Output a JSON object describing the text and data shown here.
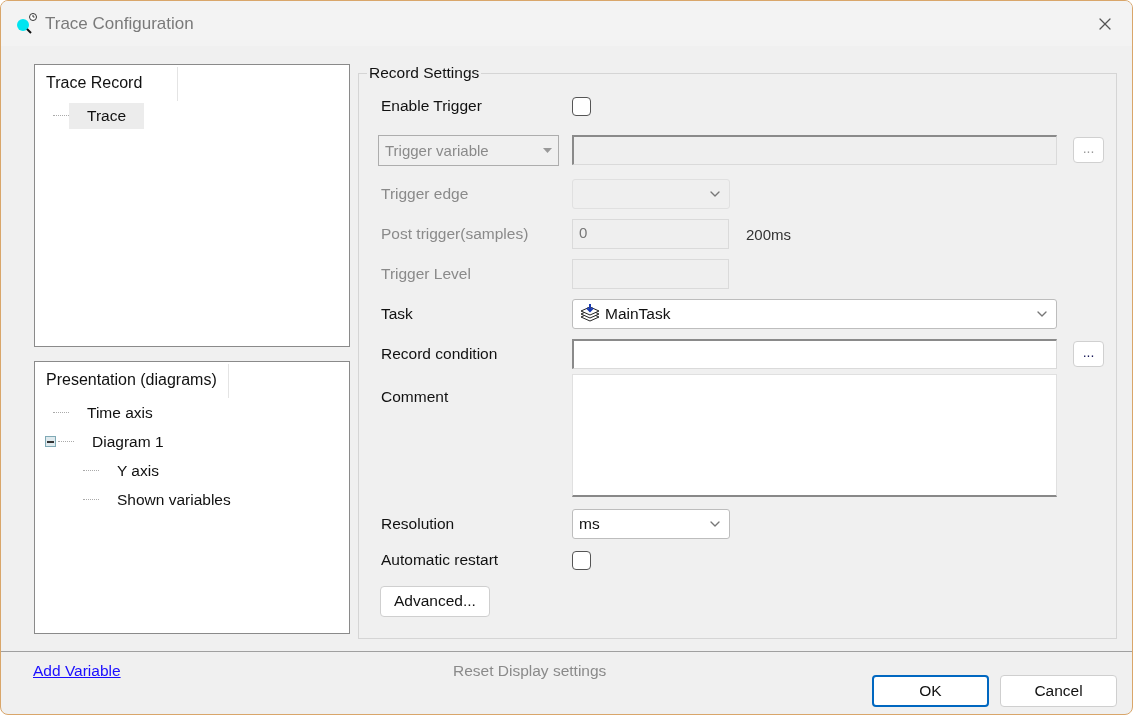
{
  "window": {
    "title": "Trace Configuration"
  },
  "trees": [
    {
      "header": "Trace Record",
      "items": [
        {
          "label": "Trace",
          "selected": true
        }
      ]
    },
    {
      "header": "Presentation (diagrams)",
      "items": [
        {
          "label": "Time axis",
          "selected": false
        },
        {
          "label": "Diagram 1",
          "selected": false,
          "expanded": true,
          "children": [
            {
              "label": "Y axis",
              "selected": false
            },
            {
              "label": "Shown variables",
              "selected": false
            }
          ]
        }
      ]
    }
  ],
  "record_settings": {
    "title": "Record Settings",
    "rows": [
      {
        "kind": "checkbox",
        "label": "Enable Trigger",
        "checked": false,
        "disabled": false
      },
      {
        "kind": "variable",
        "combo": "Trigger variable",
        "browse": "...",
        "disabled": true
      },
      {
        "kind": "dropdown",
        "label": "Trigger edge",
        "disabled": true
      },
      {
        "kind": "number",
        "label": "Post trigger(samples)",
        "value": "0",
        "unit": "200ms",
        "disabled": true
      },
      {
        "kind": "text",
        "label": "Trigger  Level",
        "disabled": true
      },
      {
        "kind": "task",
        "label": "Task",
        "value": "MainTask",
        "disabled": false
      },
      {
        "kind": "condition",
        "label": "Record condition",
        "browse": "...",
        "disabled": false
      },
      {
        "kind": "comment",
        "label": "Comment",
        "disabled": false
      },
      {
        "kind": "dropdown",
        "label": "Resolution",
        "value": "ms",
        "disabled": false
      },
      {
        "kind": "checkbox",
        "label": "Automatic restart",
        "checked": false,
        "disabled": false
      },
      {
        "kind": "button",
        "label": "Advanced..."
      }
    ]
  },
  "footer": {
    "link": "Add Variable",
    "reset": {
      "label": "Reset Display settings",
      "disabled": true
    },
    "buttons": [
      {
        "label": "OK",
        "default": true
      },
      {
        "label": "Cancel",
        "default": false
      }
    ]
  }
}
